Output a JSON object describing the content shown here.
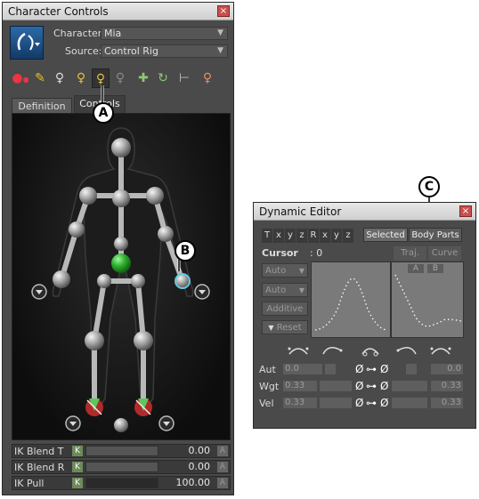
{
  "character_controls": {
    "title": "Character Controls",
    "close": "×",
    "character_label": "Character:",
    "character_value": "Mia",
    "source_label": "Source:",
    "source_value": "Control Rig",
    "tabs": [
      {
        "label": "Definition"
      },
      {
        "label": "Controls"
      }
    ],
    "toolbar_icons": [
      "pose-icon",
      "pen-icon",
      "figure-icon",
      "figure-ik-icon",
      "figure-fk-icon",
      "figure-grey-icon",
      "pin-icon",
      "rotate-pin-icon",
      "release-icon",
      "figure-color-icon"
    ],
    "rows": [
      {
        "label": "IK Blend T",
        "key": "K",
        "value": "0.00",
        "level": 0.0,
        "a": "A"
      },
      {
        "label": "IK Blend R",
        "key": "K",
        "value": "0.00",
        "level": 0.0,
        "a": "A"
      },
      {
        "label": "IK Pull",
        "key": "K",
        "value": "100.00",
        "level": 1.0,
        "a": "A"
      }
    ]
  },
  "callouts": {
    "a": "A",
    "b": "B",
    "c": "C"
  },
  "dynamic_editor": {
    "title": "Dynamic Editor",
    "close": "×",
    "axes": [
      "T",
      "x",
      "y",
      "z",
      "R",
      "x",
      "y",
      "z"
    ],
    "selected_label": "Selected",
    "body_parts_label": "Body Parts",
    "cursor_label": "Cursor",
    "cursor_value": ": 0",
    "traj_label": "Traj.",
    "curve_label": "Curve",
    "tab_a": "A",
    "tab_b": "B",
    "auto1": "Auto",
    "auto2": "Auto",
    "additive": "Additive",
    "reset": "Reset",
    "rows": [
      {
        "label": "Aut",
        "left": "0.0",
        "right": "0.0"
      },
      {
        "label": "Wgt",
        "left": "0.33",
        "right": "0.33"
      },
      {
        "label": "Vel",
        "left": "0.33",
        "right": "0.33"
      }
    ],
    "phi": "Ø",
    "link": "⊶"
  }
}
